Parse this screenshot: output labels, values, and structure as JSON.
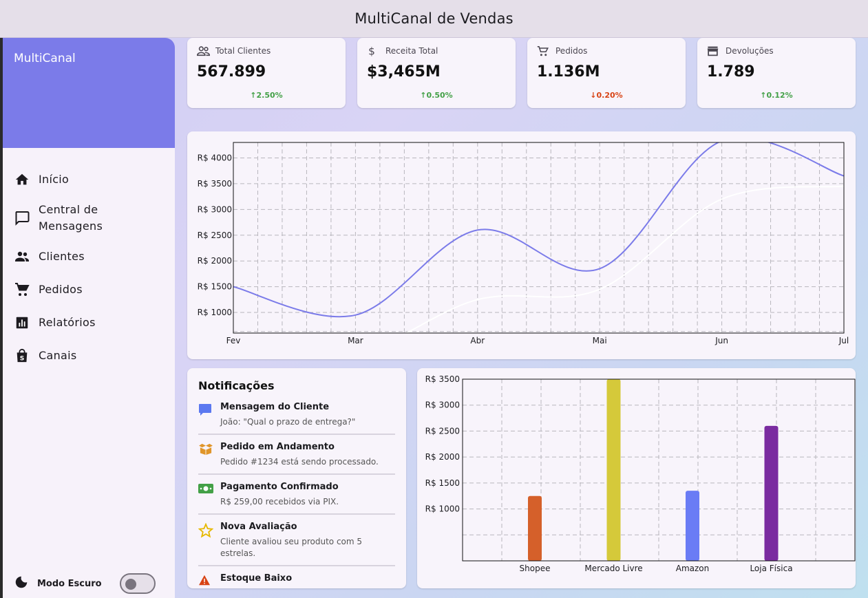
{
  "app_title": "MultiCanal de Vendas",
  "drawer": {
    "brand": "MultiCanal",
    "items": [
      {
        "label": "Início",
        "icon": "home-icon"
      },
      {
        "label": "Central de Mensagens",
        "icon": "chat-icon"
      },
      {
        "label": "Clientes",
        "icon": "people-icon"
      },
      {
        "label": "Pedidos",
        "icon": "cart-icon"
      },
      {
        "label": "Relatórios",
        "icon": "report-icon"
      },
      {
        "label": "Canais",
        "icon": "shop-icon"
      }
    ],
    "dark_mode_label": "Modo Escuro",
    "dark_mode_on": false
  },
  "kpis": [
    {
      "label": "Total Clientes",
      "value": "567.899",
      "delta": "2.50%",
      "direction": "up",
      "icon": "people-outline-icon"
    },
    {
      "label": "Receita Total",
      "value": "$3,465M",
      "delta": "0.50%",
      "direction": "up",
      "icon": "dollar-icon"
    },
    {
      "label": "Pedidos",
      "value": "1.136M",
      "delta": "0.20%",
      "direction": "down",
      "icon": "cart-outline-icon"
    },
    {
      "label": "Devoluções",
      "value": "1.789",
      "delta": "0.12%",
      "direction": "up",
      "icon": "store-icon"
    }
  ],
  "notifications": {
    "title": "Notificações",
    "items": [
      {
        "title": "Mensagem do Cliente",
        "desc": "João: \"Qual o prazo de entrega?\"",
        "icon": "message-icon"
      },
      {
        "title": "Pedido em Andamento",
        "desc": "Pedido #1234 está sendo processado.",
        "icon": "box-icon"
      },
      {
        "title": "Pagamento Confirmado",
        "desc": "R$ 259,00 recebidos via PIX.",
        "icon": "money-icon"
      },
      {
        "title": "Nova Avaliação",
        "desc": "Cliente avaliou seu produto com 5 estrelas.",
        "icon": "star-icon"
      },
      {
        "title": "Estoque Baixo",
        "desc": "",
        "icon": "warning-icon"
      }
    ]
  },
  "colors": {
    "accent": "#7b7be9",
    "up": "#43a047",
    "down": "#d84315"
  },
  "chart_data": [
    {
      "type": "line",
      "x": [
        "Fev",
        "Mar",
        "Abr",
        "Mai",
        "Jun",
        "Jul"
      ],
      "ylim": [
        600,
        4300
      ],
      "yticks": [
        "R$ 1000",
        "R$ 1500",
        "R$ 2000",
        "R$ 2500",
        "R$ 3000",
        "R$ 3500",
        "R$ 4000"
      ],
      "grid": true,
      "series": [
        {
          "values": [
            1500,
            950,
            2600,
            1850,
            4330,
            3650
          ],
          "color": "#7b7be9"
        },
        {
          "values": [
            300,
            200,
            1250,
            1450,
            3200,
            3450
          ],
          "color": "#ffffff"
        }
      ]
    },
    {
      "type": "bar",
      "categories": [
        "Shopee",
        "Mercado Livre",
        "Amazon",
        "Loja Física"
      ],
      "values": [
        1250,
        3500,
        1350,
        2600
      ],
      "colors": [
        "#d5602a",
        "#d5c93a",
        "#6a7cf5",
        "#7a2ba0"
      ],
      "ylim": [
        0,
        3500
      ],
      "yticks": [
        "R$ 1000",
        "R$ 1500",
        "R$ 2000",
        "R$ 2500",
        "R$ 3000",
        "R$ 3500"
      ],
      "grid": true
    }
  ]
}
